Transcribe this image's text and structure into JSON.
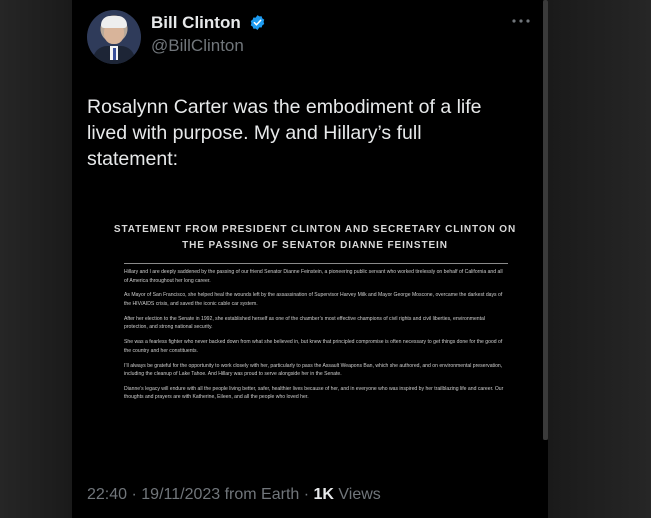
{
  "author": {
    "name": "Bill Clinton",
    "handle": "@BillClinton",
    "verified": true
  },
  "icons": {
    "verified": "verified-badge-icon",
    "more": "more-options-icon"
  },
  "colors": {
    "background": "#000000",
    "text": "#e7e9ea",
    "muted": "#71767b",
    "verified": "#1d9bf0"
  },
  "tweet": {
    "text": "Rosalynn Carter was the embodiment of a life lived with purpose. My and Hillary’s full statement:"
  },
  "statement": {
    "title_line1": "STATEMENT FROM PRESIDENT CLINTON AND SECRETARY CLINTON ON",
    "title_line2": "THE PASSING OF SENATOR DIANNE FEINSTEIN",
    "paragraphs": [
      "Hillary and I are deeply saddened by the passing of our friend Senator Dianne Feinstein, a pioneering public servant who worked tirelessly on behalf of California and all of America throughout her long career.",
      "As Mayor of San Francisco, she helped heal the wounds left by the assassination of Supervisor Harvey Milk and Mayor George Moscone, overcame the darkest days of the HIV/AIDS crisis, and saved the iconic cable car system.",
      "After her election to the Senate in 1992, she established herself as one of the chamber’s most effective champions of civil rights and civil liberties, environmental protection, and strong national security.",
      "She was a fearless fighter who never backed down from what she believed in, but knew that principled compromise is often necessary to get things done for the good of the country and her constituents.",
      "I’ll always be grateful for the opportunity to work closely with her, particularly to pass the Assault Weapons Ban, which she authored, and on environmental preservation, including the cleanup of Lake Tahoe. And Hillary was proud to serve alongside her in the Senate.",
      "Dianne’s legacy will endure with all the people living better, safer, healthier lives because of her, and in everyone who was inspired by her trailblazing life and career. Our thoughts and prayers are with Katherine, Eileen, and all the people who loved her."
    ]
  },
  "meta": {
    "time": "22:40",
    "separator1": " · ",
    "date": "19/11/2023",
    "source": " from Earth",
    "separator2": " · ",
    "views_count": "1K",
    "views_label": " Views"
  }
}
